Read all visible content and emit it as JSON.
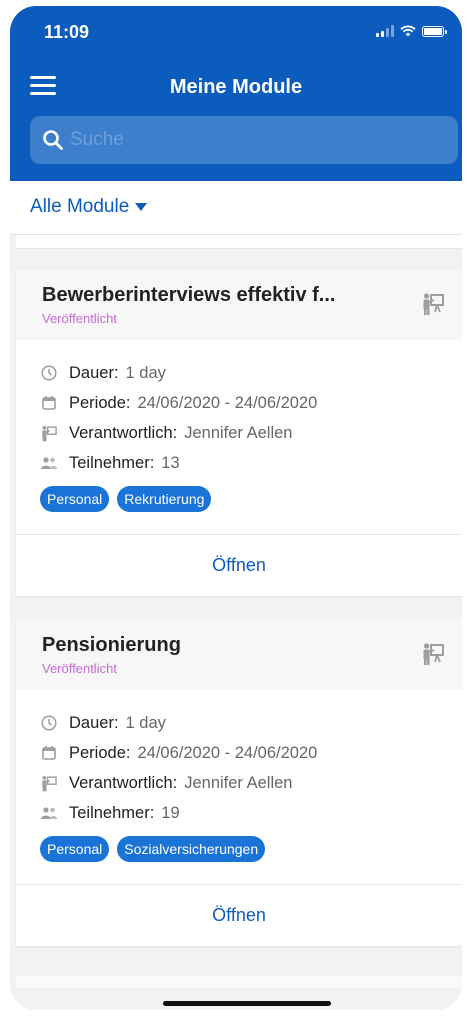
{
  "status_bar": {
    "time": "11:09"
  },
  "header": {
    "title": "Meine Module"
  },
  "search": {
    "placeholder": "Suche"
  },
  "filter": {
    "label": "Alle Module"
  },
  "labels": {
    "duration": "Dauer:",
    "period": "Periode:",
    "responsible": "Verantwortlich:",
    "participants": "Teilnehmer:"
  },
  "modules": [
    {
      "title": "Bewerberinterviews effektiv f...",
      "status": "Veröffentlicht",
      "duration": "1 day",
      "period": "24/06/2020 - 24/06/2020",
      "responsible": "Jennifer Aellen",
      "participants": "13",
      "tags": [
        "Personal",
        "Rekrutierung"
      ],
      "open_label": "Öffnen"
    },
    {
      "title": "Pensionierung",
      "status": "Veröffentlicht",
      "duration": "1 day",
      "period": "24/06/2020 - 24/06/2020",
      "responsible": "Jennifer Aellen",
      "participants": "19",
      "tags": [
        "Personal",
        "Sozialversicherungen"
      ],
      "open_label": "Öffnen"
    }
  ],
  "colors": {
    "primary": "#0b5cbd",
    "status_published": "#c96ad6",
    "tag": "#1a73d6"
  },
  "icons": {
    "clock": "clock-icon",
    "calendar": "calendar-icon",
    "presenter": "presenter-icon",
    "people": "people-icon",
    "search": "search-icon",
    "menu": "menu-icon"
  }
}
